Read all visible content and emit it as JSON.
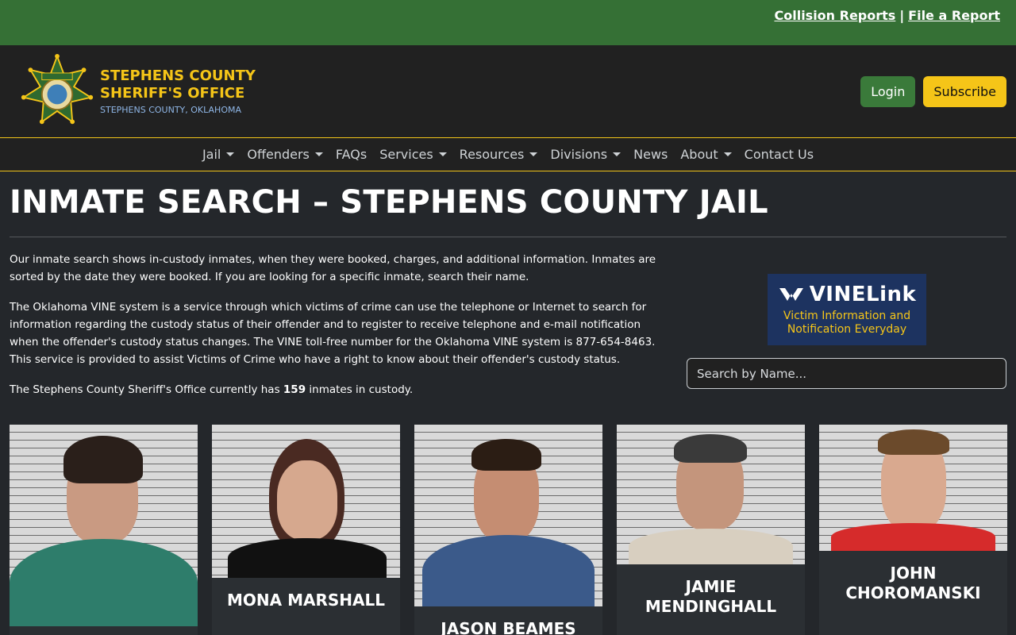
{
  "topbar": {
    "link1": "Collision Reports",
    "separator": "|",
    "link2": "File a Report"
  },
  "brand": {
    "line1": "STEPHENS COUNTY",
    "line2": "SHERIFF'S OFFICE",
    "line3": "STEPHENS COUNTY, OKLAHOMA",
    "badge_icon": "sheriff-star-badge"
  },
  "header": {
    "login_label": "Login",
    "subscribe_label": "Subscribe"
  },
  "nav": {
    "items": [
      {
        "label": "Jail",
        "dropdown": true
      },
      {
        "label": "Offenders",
        "dropdown": true
      },
      {
        "label": "FAQs",
        "dropdown": false
      },
      {
        "label": "Services",
        "dropdown": true
      },
      {
        "label": "Resources",
        "dropdown": true
      },
      {
        "label": "Divisions",
        "dropdown": true
      },
      {
        "label": "News",
        "dropdown": false
      },
      {
        "label": "About",
        "dropdown": true
      },
      {
        "label": "Contact Us",
        "dropdown": false
      }
    ]
  },
  "page": {
    "title": "INMATE SEARCH – STEPHENS COUNTY JAIL",
    "p1": "Our inmate search shows in-custody inmates, when they were booked, charges, and additional information. Inmates are sorted by the date they were booked. If you are looking for a specific inmate, search their name.",
    "p2": "The Oklahoma VINE system is a service through which victims of crime can use the telephone or Internet to search for information regarding the custody status of their offender and to register to receive telephone and e-mail notification when the offender's custody status changes. The VINE toll-free number for the Oklahoma VINE system is 877-654-8463. This service is provided to assist Victims of Crime who have a right to know about their offender's custody status.",
    "p3_before": "The Stephens County Sheriff's Office currently has ",
    "inmate_count": "159",
    "p3_after": " inmates in custody."
  },
  "vine": {
    "logo_text": "VINELink",
    "tagline_1": "Victim Information and",
    "tagline_2": "Notification Everyday"
  },
  "search": {
    "placeholder": "Search by Name..."
  },
  "inmates": [
    {
      "name": "",
      "shirt_color": "#2e7d6b"
    },
    {
      "name": "MONA MARSHALL",
      "shirt_color": "#111111"
    },
    {
      "name": "JASON BEAMES",
      "shirt_color": "#3b5a8a"
    },
    {
      "name": "JAMIE MENDINGHALL",
      "shirt_color": "#d8cfc0"
    },
    {
      "name": "JOHN CHOROMANSKI",
      "shirt_color": "#d62b2b"
    }
  ],
  "colors": {
    "top_green": "#357035",
    "accent_gold": "#f5c518",
    "page_bg": "#24272b"
  }
}
